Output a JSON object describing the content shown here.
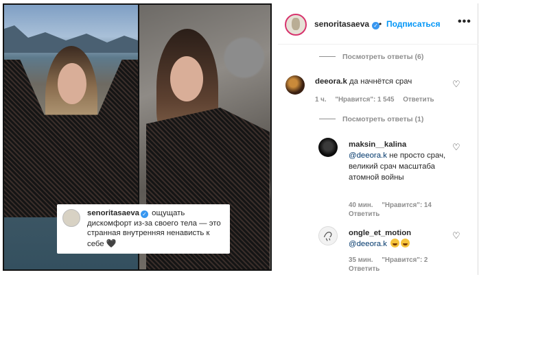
{
  "caption": {
    "username": "senoritasaeva",
    "text": "ощущать дискомфорт из-за своего тела — это странная внутренняя ненависть к себе"
  },
  "post_header": {
    "username": "senoritasaeva",
    "separator": "•",
    "follow_label": "Подписаться",
    "more_label": "•••"
  },
  "comments": {
    "view_replies_top": "Посмотреть ответы (6)",
    "main": {
      "username": "deeora.k",
      "text": "да начнётся срач",
      "time": "1 ч.",
      "likes": "\"Нравится\": 1 545",
      "reply": "Ответить"
    },
    "view_replies_main": "Посмотреть ответы (1)",
    "reply1": {
      "username": "maksin__kalina",
      "mention": "@deeora.k",
      "text": " не просто срач, великий срач масштаба атомной войны",
      "time": "40 мин.",
      "likes": "\"Нравится\": 14",
      "reply": "Ответить"
    },
    "reply2": {
      "username": "ongle_et_motion",
      "mention": "@deeora.k",
      "time": "35 мин.",
      "likes": "\"Нравится\": 2",
      "reply": "Ответить"
    }
  },
  "icons": {
    "heart": "♡",
    "verified": "✓",
    "black_heart": "🖤"
  },
  "colors": {
    "follow": "#0095f6",
    "mention": "#00376b",
    "meta": "#8e8e8e",
    "verified": "#3897f0"
  }
}
